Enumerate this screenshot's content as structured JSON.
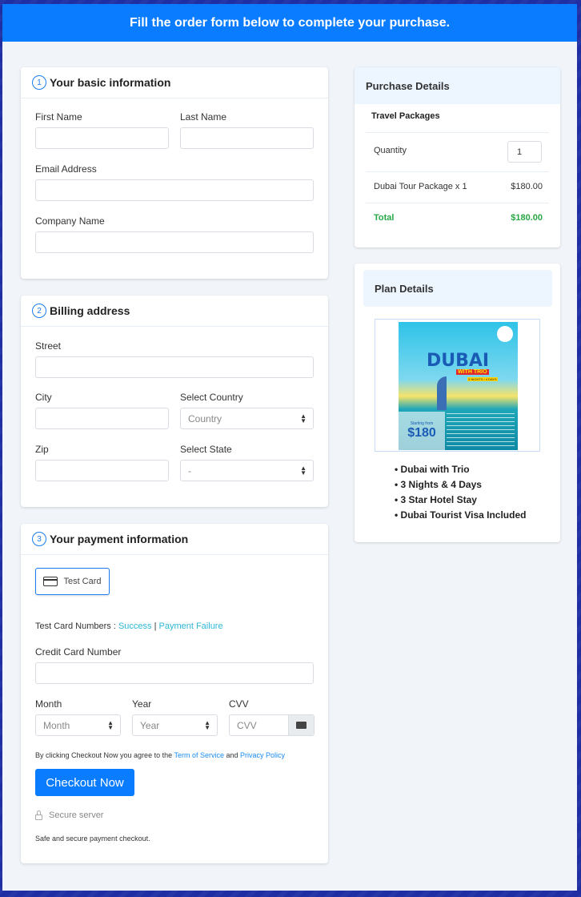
{
  "header": {
    "title": "Fill the order form below to complete your purchase."
  },
  "basic_info": {
    "step": "1",
    "title": "Your basic information",
    "first_name": {
      "label": "First Name",
      "value": ""
    },
    "last_name": {
      "label": "Last Name",
      "value": ""
    },
    "email": {
      "label": "Email Address",
      "value": ""
    },
    "company": {
      "label": "Company Name",
      "value": ""
    }
  },
  "billing": {
    "step": "2",
    "title": "Billing address",
    "street": {
      "label": "Street",
      "value": ""
    },
    "city": {
      "label": "City",
      "value": ""
    },
    "country": {
      "label": "Select Country",
      "selected": "Country"
    },
    "zip": {
      "label": "Zip",
      "value": ""
    },
    "state": {
      "label": "Select State",
      "selected": "-"
    }
  },
  "payment": {
    "step": "3",
    "title": "Your payment information",
    "test_card_button": "Test Card",
    "test_card_numbers_label": "Test Card Numbers :",
    "success_link": "Success",
    "separator": "|",
    "failure_link": "Payment Failure",
    "card_number": {
      "label": "Credit Card Number",
      "value": ""
    },
    "month": {
      "label": "Month",
      "selected": "Month"
    },
    "year": {
      "label": "Year",
      "selected": "Year"
    },
    "cvv": {
      "label": "CVV",
      "placeholder": "CVV"
    },
    "agree_prefix": "By clicking Checkout Now you agree to the",
    "terms_link": "Term of Service",
    "agree_and": "and",
    "privacy_link": "Privacy Policy",
    "checkout_button": "Checkout Now",
    "secure_server": "Secure server",
    "safe_text": "Safe and secure payment checkout."
  },
  "purchase_details": {
    "title": "Purchase Details",
    "category": "Travel Packages",
    "quantity_label": "Quantity",
    "quantity_value": "1",
    "item_name": "Dubai Tour Package x 1",
    "item_price": "$180.00",
    "total_label": "Total",
    "total_value": "$180.00",
    "total_color": "#28a745"
  },
  "plan_details": {
    "title": "Plan Details",
    "poster": {
      "headline": "DUBAI",
      "tagline": "WITH TRIO",
      "duration": "3 NIGHTS / 4 DAYS",
      "starting_from": "Starting from",
      "price": "$180"
    },
    "features": [
      "Dubai with Trio",
      "3 Nights & 4 Days",
      "3 Star Hotel Stay",
      "Dubai Tourist Visa Included"
    ]
  },
  "colors": {
    "primary": "#0a7cff",
    "success": "#28a745",
    "link": "#1a8cf0"
  }
}
